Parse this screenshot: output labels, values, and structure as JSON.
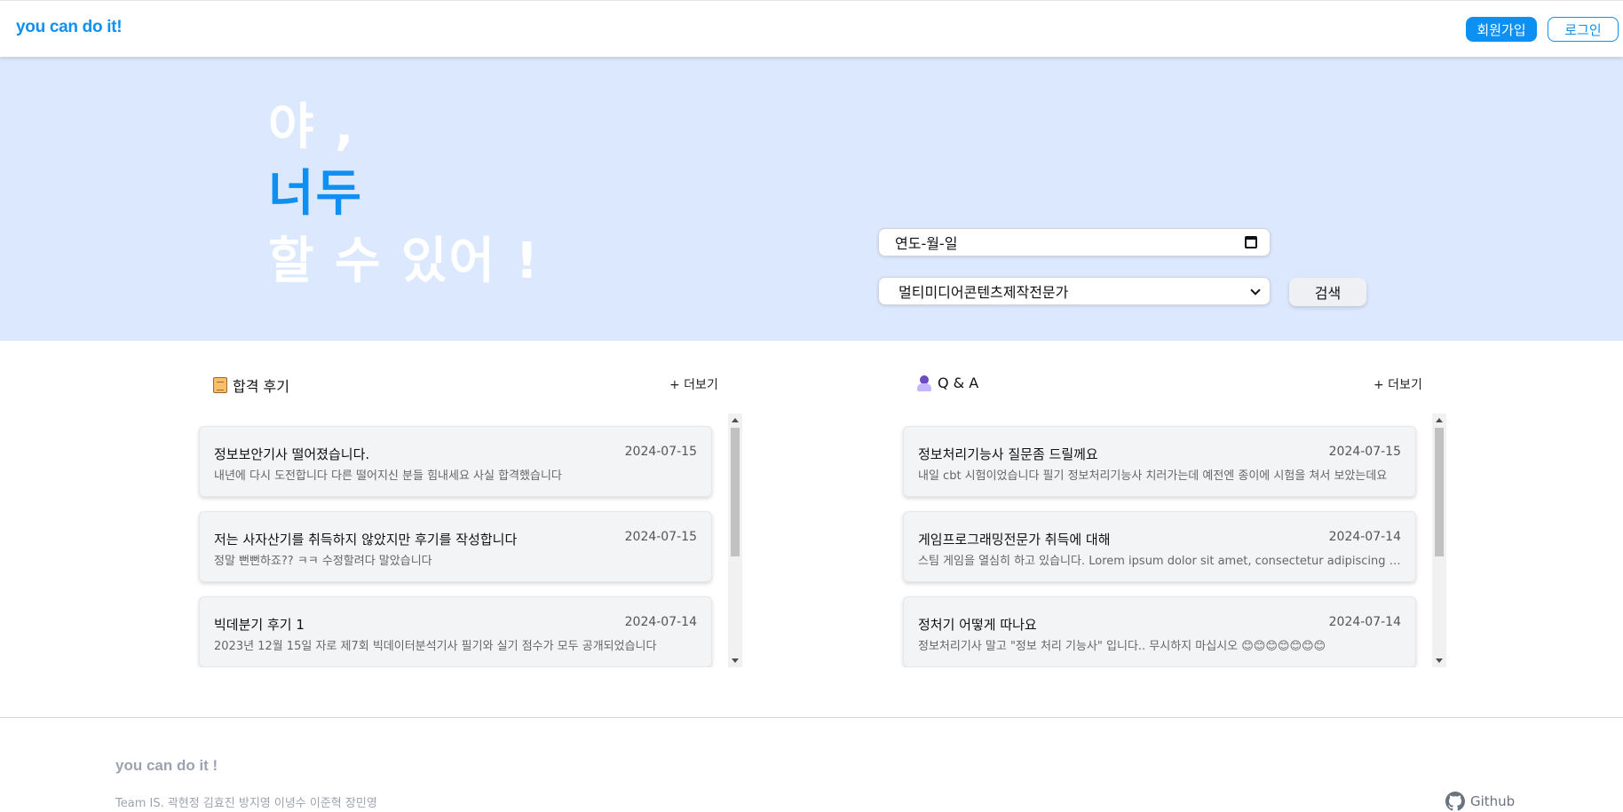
{
  "header": {
    "logo": "you can do it!",
    "signup_label": "회원가입",
    "login_label": "로그인"
  },
  "hero": {
    "line1": "야 ,",
    "line2": "너두",
    "line3": "할 수 있어 !",
    "date_placeholder": "연도-월-일",
    "selected_certificate": "멀티미디어콘텐츠제작전문가",
    "search_label": "검색"
  },
  "reviews": {
    "title": "합격 후기",
    "more_label": "+ 더보기",
    "items": [
      {
        "title": "정보보안기사 떨어졌습니다.",
        "date": "2024-07-15",
        "body": "내년에 다시 도전합니다 다른 떨어지신 분들 힘내세요 사실 합격했습니다"
      },
      {
        "title": "저는 사자산기를 취득하지 않았지만 후기를 작성합니다",
        "date": "2024-07-15",
        "body": "정말 뻔뻔하죠?? ㅋㅋ 수정할려다 말았습니다"
      },
      {
        "title": "빅데분기 후기 1",
        "date": "2024-07-14",
        "body": "2023년 12월 15일 자로 제7회 빅데이터분석기사 필기와 실기 점수가 모두 공개되었습니다"
      }
    ]
  },
  "qna": {
    "title": "Q & A",
    "more_label": "+ 더보기",
    "items": [
      {
        "title": "정보처리기능사 질문좀 드릴께요",
        "date": "2024-07-15",
        "body": "내일 cbt 시험이었습니다 필기 정보처리기능사 치러가는데 예전엔 종이에 시험을 쳐서 보았는데요"
      },
      {
        "title": "게임프로그래밍전문가 취득에 대해",
        "date": "2024-07-14",
        "body": "스팀 게임을 열심히 하고 있습니다. Lorem ipsum dolor sit amet, consectetur adipiscing elit"
      },
      {
        "title": "정처기 어떻게 따나요",
        "date": "2024-07-14",
        "body": "정보처리기사 말고 \"정보 처리 기능사\" 입니다.. 무시하지 마십시오 😊😊😊😊😊😊😊"
      }
    ]
  },
  "footer": {
    "logo": "you can do it !",
    "team": "Team IS. 곽현정 김효진 방지영 이녕수 이준혁 장민영",
    "github_label": "Github"
  },
  "colors": {
    "accent": "#0e8ff2",
    "hero_bg": "#dbe8fd"
  }
}
